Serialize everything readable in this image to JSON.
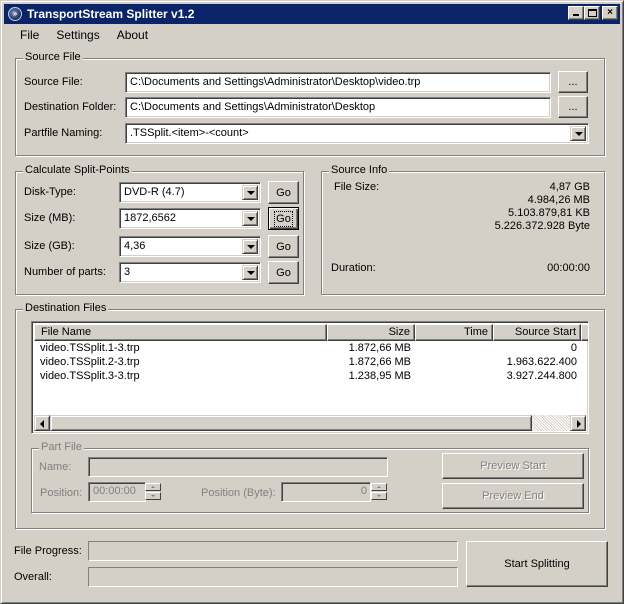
{
  "window": {
    "title": "TransportStream Splitter v1.2",
    "icon": "app-logo-icon",
    "controls": {
      "minimize": "minimize-icon",
      "maximize": "maximize-icon",
      "close": "×"
    }
  },
  "menu": [
    "File",
    "Settings",
    "About"
  ],
  "source_file": {
    "group_label": "Source File",
    "source_label": "Source File:",
    "source_value": "C:\\Documents and Settings\\Administrator\\Desktop\\video.trp",
    "dest_label": "Destination Folder:",
    "dest_value": "C:\\Documents and Settings\\Administrator\\Desktop",
    "browse_label": "...",
    "naming_label": "Partfile Naming:",
    "naming_value": ".TSSplit.<item>-<count>"
  },
  "split_points": {
    "group_label": "Calculate Split-Points",
    "rows": [
      {
        "label": "Disk-Type:",
        "value": "DVD-R (4.7)",
        "button": "Go"
      },
      {
        "label": "Size (MB):",
        "value": "1872,6562",
        "button": "Go"
      },
      {
        "label": "Size (GB):",
        "value": "4,36",
        "button": "Go"
      },
      {
        "label": "Number of parts:",
        "value": "3",
        "button": "Go"
      }
    ]
  },
  "source_info": {
    "group_label": "Source Info",
    "file_size_label": "File Size:",
    "sizes": [
      "4,87 GB",
      "4.984,26 MB",
      "5.103.879,81 KB",
      "5.226.372.928 Byte"
    ],
    "duration_label": "Duration:",
    "duration_value": "00:00:00"
  },
  "destination_files": {
    "group_label": "Destination Files",
    "columns": [
      "File Name",
      "Size",
      "Time",
      "Source Start"
    ],
    "rows": [
      {
        "name": "video.TSSplit.1-3.trp",
        "size": "1.872,66 MB",
        "time": "",
        "start": "0"
      },
      {
        "name": "video.TSSplit.2-3.trp",
        "size": "1.872,66 MB",
        "time": "",
        "start": "1.963.622.400"
      },
      {
        "name": "video.TSSplit.3-3.trp",
        "size": "1.238,95 MB",
        "time": "",
        "start": "3.927.244.800"
      }
    ]
  },
  "part_file": {
    "group_label": "Part File",
    "name_label": "Name:",
    "name_value": "",
    "position_label": "Position:",
    "position_value": "00:00:00",
    "position_byte_label": "Position (Byte):",
    "position_byte_value": "0",
    "preview_start": "Preview Start",
    "preview_end": "Preview End"
  },
  "progress": {
    "file_label": "File Progress:",
    "file_value": 0,
    "overall_label": "Overall:",
    "overall_value": 0,
    "start_button": "Start Splitting"
  }
}
